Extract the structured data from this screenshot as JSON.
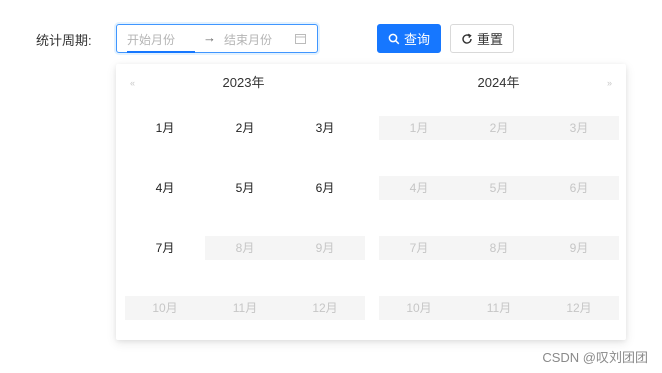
{
  "form": {
    "label": "统计周期:",
    "start_placeholder": "开始月份",
    "separator": "→",
    "end_placeholder": "结束月份",
    "query_label": "查询",
    "reset_label": "重置"
  },
  "picker": {
    "left_year": "2023年",
    "right_year": "2024年",
    "left_months": [
      [
        "1月",
        "2月",
        "3月"
      ],
      [
        "4月",
        "5月",
        "6月"
      ],
      [
        "7月",
        "8月",
        "9月"
      ],
      [
        "10月",
        "11月",
        "12月"
      ]
    ],
    "left_disabled": [
      [
        false,
        false,
        false
      ],
      [
        false,
        false,
        false
      ],
      [
        false,
        true,
        true
      ],
      [
        true,
        true,
        true
      ]
    ],
    "right_months": [
      [
        "1月",
        "2月",
        "3月"
      ],
      [
        "4月",
        "5月",
        "6月"
      ],
      [
        "7月",
        "8月",
        "9月"
      ],
      [
        "10月",
        "11月",
        "12月"
      ]
    ],
    "right_disabled": [
      [
        true,
        true,
        true
      ],
      [
        true,
        true,
        true
      ],
      [
        true,
        true,
        true
      ],
      [
        true,
        true,
        true
      ]
    ]
  },
  "theme": {
    "primary": "#1677ff",
    "disabled_bg": "#f5f5f5",
    "disabled_text": "#c6c6c6"
  },
  "icons": {
    "query": "search-icon",
    "reset": "reload-icon",
    "picker": "calendar-icon",
    "prev": "double-left-icon",
    "next": "double-right-icon"
  },
  "watermark": "CSDN @叹刘团团"
}
